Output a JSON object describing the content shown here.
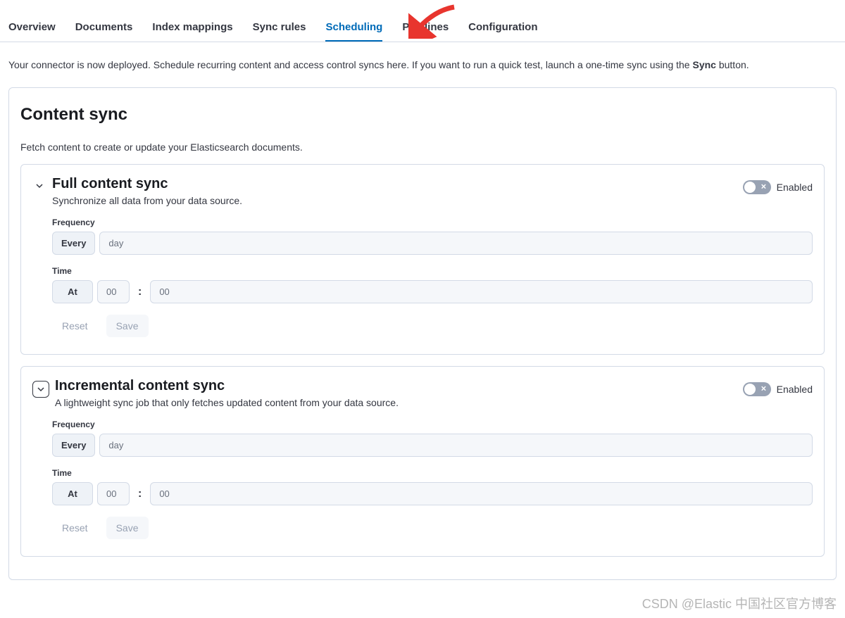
{
  "tabs": {
    "overview": "Overview",
    "documents": "Documents",
    "index_mappings": "Index mappings",
    "sync_rules": "Sync rules",
    "scheduling": "Scheduling",
    "pipelines": "Pipelines",
    "configuration": "Configuration"
  },
  "intro": {
    "pre": "Your connector is now deployed. Schedule recurring content and access control syncs here. If you want to run a quick test, launch a one-time sync using the ",
    "bold": "Sync",
    "post": " button."
  },
  "panel": {
    "title": "Content sync",
    "subtitle": "Fetch content to create or update your Elasticsearch documents."
  },
  "full_sync": {
    "title": "Full content sync",
    "desc": "Synchronize all data from your data source.",
    "enabled_label": "Enabled",
    "freq_label": "Frequency",
    "every": "Every",
    "freq_placeholder": "day",
    "time_label": "Time",
    "at": "At",
    "hour_placeholder": "00",
    "min_placeholder": "00",
    "reset": "Reset",
    "save": "Save"
  },
  "incr_sync": {
    "title": "Incremental content sync",
    "desc": "A lightweight sync job that only fetches updated content from your data source.",
    "enabled_label": "Enabled",
    "freq_label": "Frequency",
    "every": "Every",
    "freq_placeholder": "day",
    "time_label": "Time",
    "at": "At",
    "hour_placeholder": "00",
    "min_placeholder": "00",
    "reset": "Reset",
    "save": "Save"
  },
  "watermark": "CSDN @Elastic 中国社区官方博客"
}
